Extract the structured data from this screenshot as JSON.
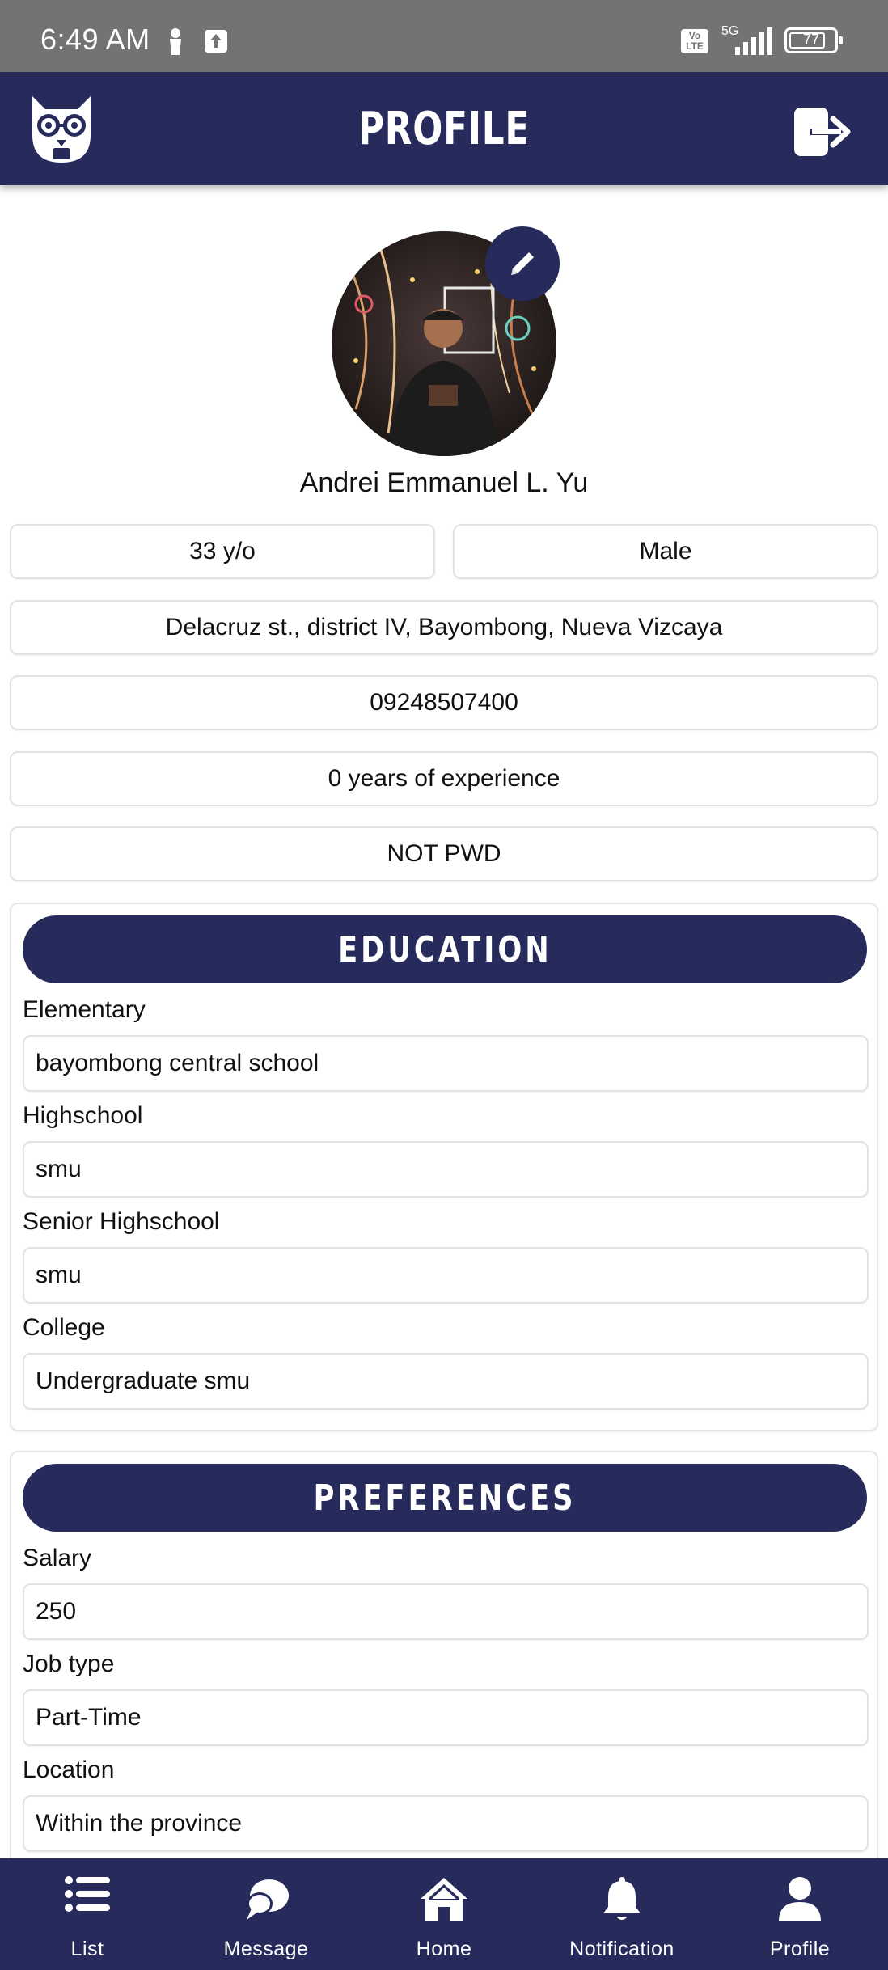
{
  "status_bar": {
    "time": "6:49 AM",
    "network": "5G",
    "volte": "Vo LTE",
    "battery": "77",
    "icons": [
      "person-icon",
      "upload-icon",
      "volte-icon",
      "signal-icon",
      "battery-icon"
    ]
  },
  "app_bar": {
    "title": "PROFILE",
    "logo_icon": "owl-logo-icon",
    "logout_icon": "logout-icon"
  },
  "profile": {
    "name": "Andrei Emmanuel L. Yu",
    "age": "33 y/o",
    "gender": "Male",
    "address": "Delacruz st., district IV, Bayombong, Nueva Vizcaya",
    "phone": "09248507400",
    "experience": "0 years of experience",
    "pwd_status": "NOT PWD",
    "edit_icon": "pencil-icon"
  },
  "education": {
    "title": "EDUCATION",
    "fields": [
      {
        "label": "Elementary",
        "value": "bayombong central school"
      },
      {
        "label": "Highschool",
        "value": "smu"
      },
      {
        "label": "Senior Highschool",
        "value": "smu"
      },
      {
        "label": "College",
        "value": "Undergraduate smu"
      }
    ]
  },
  "preferences": {
    "title": "PREFERENCES",
    "fields": [
      {
        "label": "Salary",
        "value": "250"
      },
      {
        "label": "Job type",
        "value": "Part-Time"
      },
      {
        "label": "Location",
        "value": "Within the province"
      }
    ]
  },
  "bottom_nav": {
    "items": [
      {
        "label": "List",
        "icon": "list-icon"
      },
      {
        "label": "Message",
        "icon": "chat-bubble-icon"
      },
      {
        "label": "Home",
        "icon": "home-icon"
      },
      {
        "label": "Notification",
        "icon": "bell-icon"
      },
      {
        "label": "Profile",
        "icon": "user-icon"
      }
    ]
  },
  "colors": {
    "primary": "#272b5c",
    "status_bar": "#737373",
    "background": "#ffffff",
    "border": "#e2e2e2"
  }
}
